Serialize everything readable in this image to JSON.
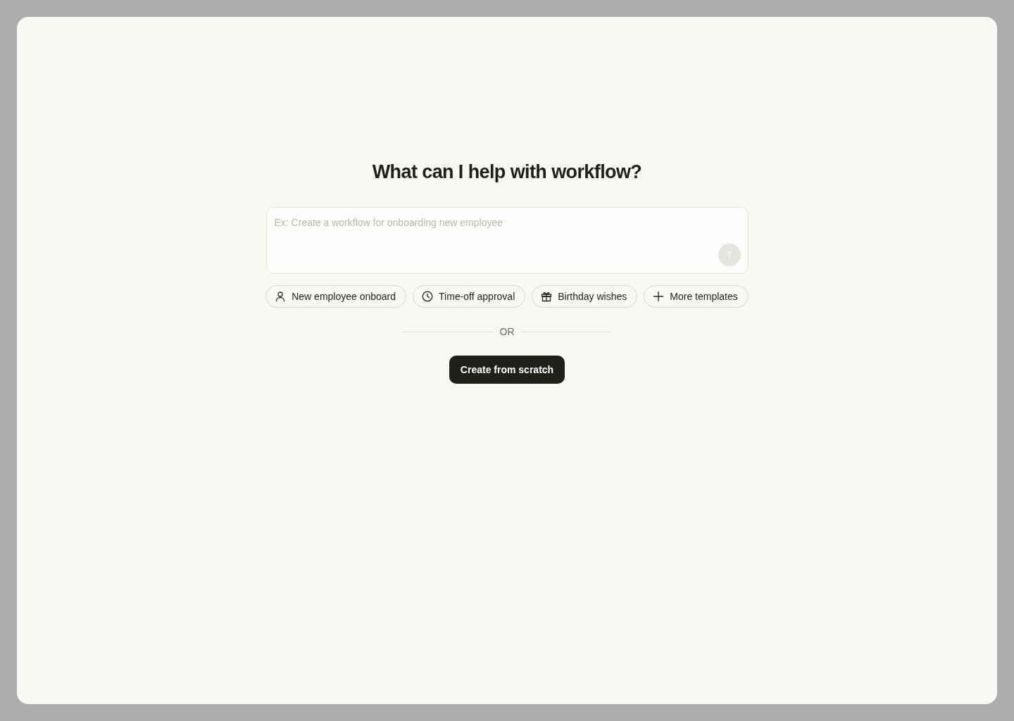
{
  "heading": "What can I help with workflow?",
  "prompt": {
    "placeholder": "Ex: Create a workflow for onboarding new employee",
    "send_disabled": true
  },
  "templates": [
    {
      "label": "New employee onboard"
    },
    {
      "label": "Time-off approval"
    },
    {
      "label": "Birthday wishes"
    },
    {
      "label": "More templates"
    }
  ],
  "divider_label": "OR",
  "primary_button": "Create from scratch"
}
